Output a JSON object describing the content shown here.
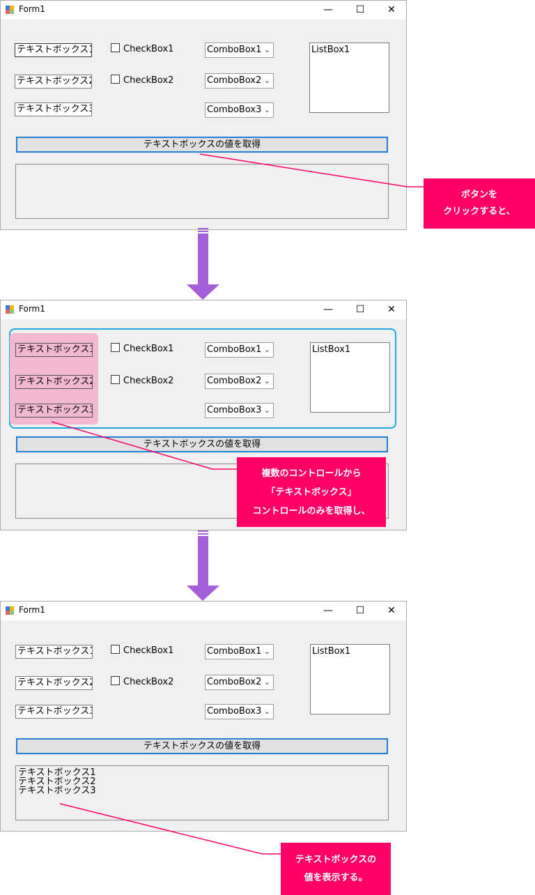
{
  "window_title": "Form1",
  "controls": {
    "minimize": "—",
    "maximize": "☐",
    "close": "✕"
  },
  "form": {
    "textboxes": [
      "テキストボックス1",
      "テキストボックス2",
      "テキストボックス3"
    ],
    "checkboxes": [
      "CheckBox1",
      "CheckBox2"
    ],
    "comboboxes": [
      "ComboBox1",
      "ComboBox2",
      "ComboBox3"
    ],
    "listbox": "ListBox1",
    "button": "テキストボックスの値を取得"
  },
  "result_lines": [
    "テキストボックス1",
    "テキストボックス2",
    "テキストボックス3"
  ],
  "callouts": {
    "step1": [
      "ボタンを",
      "クリックすると、"
    ],
    "step2": [
      "複数のコントロールから",
      "「テキストボックス」",
      "コントロールのみを取得し、"
    ],
    "step3": [
      "テキストボックスの",
      "値を表示する。"
    ]
  },
  "colors": {
    "accent": "#ff0066",
    "arrow": "#a55fd6",
    "highlight_pink": "#f2b8cf",
    "highlight_cyan": "#1ea8e0",
    "button_border": "#1e7fd4"
  }
}
